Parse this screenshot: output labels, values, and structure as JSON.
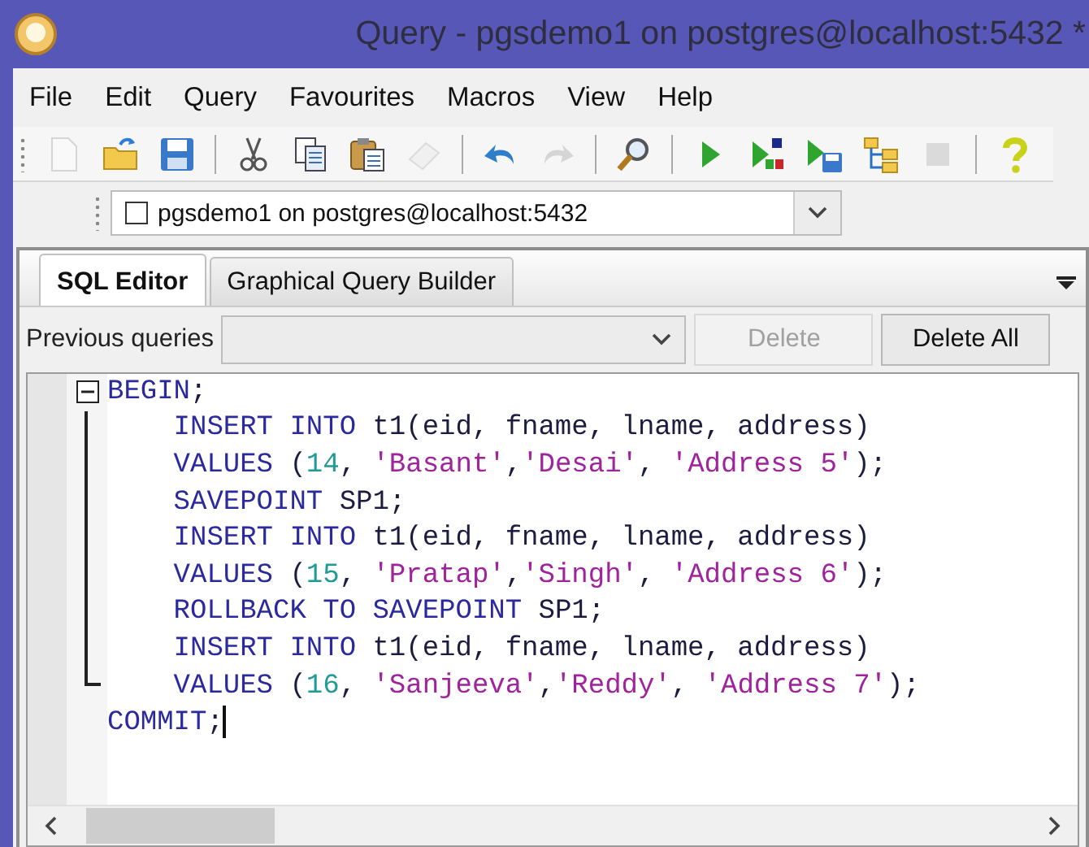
{
  "window": {
    "title": "Query - pgsdemo1 on postgres@localhost:5432 *"
  },
  "menu": [
    "File",
    "Edit",
    "Query",
    "Favourites",
    "Macros",
    "View",
    "Help"
  ],
  "toolbar": [
    {
      "kind": "new",
      "disabled": true
    },
    {
      "kind": "open",
      "disabled": false
    },
    {
      "kind": "save",
      "disabled": false
    },
    {
      "kind": "separator"
    },
    {
      "kind": "cut",
      "disabled": false
    },
    {
      "kind": "copy",
      "disabled": false
    },
    {
      "kind": "paste",
      "disabled": false
    },
    {
      "kind": "clear",
      "disabled": true
    },
    {
      "kind": "separator"
    },
    {
      "kind": "undo",
      "disabled": false
    },
    {
      "kind": "redo",
      "disabled": true
    },
    {
      "kind": "separator"
    },
    {
      "kind": "find",
      "disabled": false
    },
    {
      "kind": "separator"
    },
    {
      "kind": "execute",
      "disabled": false
    },
    {
      "kind": "execute-script",
      "disabled": false
    },
    {
      "kind": "execute-to-file",
      "disabled": false
    },
    {
      "kind": "explain",
      "disabled": false
    },
    {
      "kind": "cancel",
      "disabled": true
    },
    {
      "kind": "separator"
    },
    {
      "kind": "help",
      "disabled": false
    }
  ],
  "connection": {
    "value": "pgsdemo1 on postgres@localhost:5432",
    "checked": false
  },
  "tabs": [
    {
      "label": "SQL Editor",
      "selected": true
    },
    {
      "label": "Graphical Query Builder",
      "selected": false
    }
  ],
  "previous_queries": {
    "label": "Previous queries",
    "buttons": [
      {
        "label": "Delete",
        "disabled": true
      },
      {
        "label": "Delete All",
        "disabled": false
      }
    ]
  },
  "code": [
    {
      "expanded": true,
      "tokens": [
        {
          "kind": "keyword",
          "text": "BEGIN"
        },
        {
          "kind": "punct",
          "text": ";"
        }
      ],
      "children": [
        {
          "tokens": [
            {
              "kind": "keyword",
              "text": "INSERT INTO"
            },
            {
              "kind": "ident",
              "text": " t1(eid, fname, lname, address)"
            }
          ]
        },
        {
          "tokens": [
            {
              "kind": "keyword",
              "text": "VALUES"
            },
            {
              "kind": "punct",
              "text": " ("
            },
            {
              "kind": "number",
              "text": "14"
            },
            {
              "kind": "punct",
              "text": ", "
            },
            {
              "kind": "string",
              "text": "'Basant'"
            },
            {
              "kind": "punct",
              "text": ","
            },
            {
              "kind": "string",
              "text": "'Desai'"
            },
            {
              "kind": "punct",
              "text": ", "
            },
            {
              "kind": "string",
              "text": "'Address 5'"
            },
            {
              "kind": "punct",
              "text": ");"
            }
          ]
        },
        {
          "tokens": [
            {
              "kind": "keyword",
              "text": "SAVEPOINT"
            },
            {
              "kind": "ident",
              "text": " SP1;"
            }
          ]
        },
        {
          "tokens": [
            {
              "kind": "keyword",
              "text": "INSERT INTO"
            },
            {
              "kind": "ident",
              "text": " t1(eid, fname, lname, address)"
            }
          ]
        },
        {
          "tokens": [
            {
              "kind": "keyword",
              "text": "VALUES"
            },
            {
              "kind": "punct",
              "text": " ("
            },
            {
              "kind": "number",
              "text": "15"
            },
            {
              "kind": "punct",
              "text": ", "
            },
            {
              "kind": "string",
              "text": "'Pratap'"
            },
            {
              "kind": "punct",
              "text": ","
            },
            {
              "kind": "string",
              "text": "'Singh'"
            },
            {
              "kind": "punct",
              "text": ", "
            },
            {
              "kind": "string",
              "text": "'Address 6'"
            },
            {
              "kind": "punct",
              "text": ");"
            }
          ]
        },
        {
          "tokens": [
            {
              "kind": "keyword",
              "text": "ROLLBACK TO SAVEPOINT"
            },
            {
              "kind": "ident",
              "text": " SP1;"
            }
          ]
        },
        {
          "tokens": [
            {
              "kind": "keyword",
              "text": "INSERT INTO"
            },
            {
              "kind": "ident",
              "text": " t1(eid, fname, lname, address)"
            }
          ]
        },
        {
          "tokens": [
            {
              "kind": "keyword",
              "text": "VALUES"
            },
            {
              "kind": "punct",
              "text": " ("
            },
            {
              "kind": "number",
              "text": "16"
            },
            {
              "kind": "punct",
              "text": ", "
            },
            {
              "kind": "string",
              "text": "'Sanjeeva'"
            },
            {
              "kind": "punct",
              "text": ","
            },
            {
              "kind": "string",
              "text": "'Reddy'"
            },
            {
              "kind": "punct",
              "text": ", "
            },
            {
              "kind": "string",
              "text": "'Address 7'"
            },
            {
              "kind": "punct",
              "text": ");"
            }
          ]
        }
      ]
    },
    {
      "caret": true,
      "tokens": [
        {
          "kind": "keyword",
          "text": "COMMIT"
        },
        {
          "kind": "punct",
          "text": ";"
        }
      ]
    }
  ]
}
